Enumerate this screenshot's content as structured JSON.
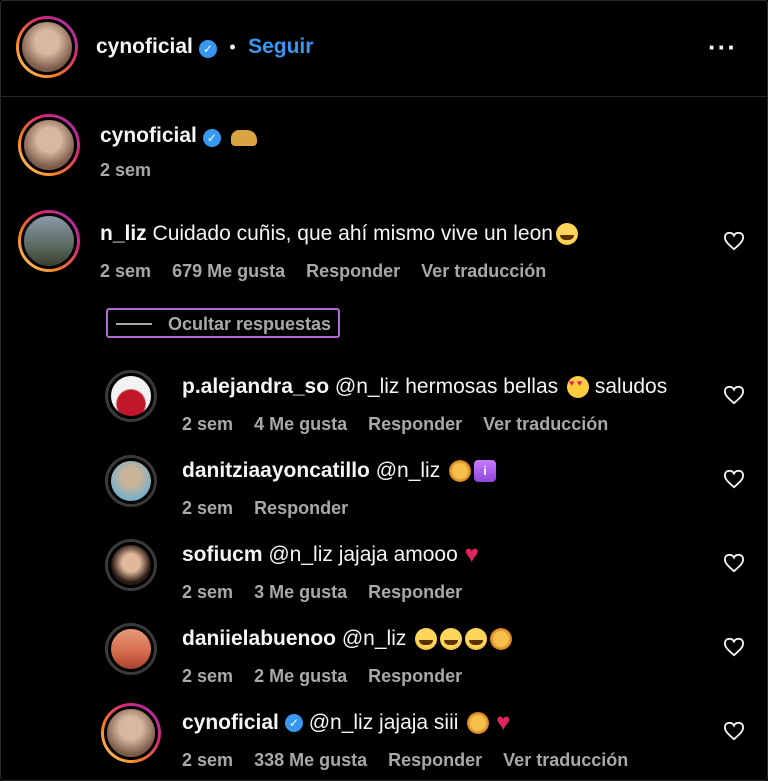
{
  "header": {
    "username": "cynoficial",
    "separator": "•",
    "follow_label": "Seguir",
    "more_icon": "more-horizontal-icon"
  },
  "caption": {
    "username": "cynoficial",
    "emoji": "leopard-emoji",
    "time": "2 sem"
  },
  "comment": {
    "username": "n_liz",
    "text": "Cuidado cuñis, que ahí mismo vive un leon",
    "emoji": "laughing-emoji",
    "time": "2 sem",
    "likes": "679 Me gusta",
    "reply_label": "Responder",
    "translate_label": "Ver traducción",
    "hide_replies_label": "Ocultar respuestas"
  },
  "replies": [
    {
      "username": "p.alejandra_so",
      "text": "@n_liz hermosas bellas",
      "emoji_after": "heart-eyes-emoji",
      "text2": "saludos",
      "time": "2 sem",
      "likes": "4 Me gusta",
      "reply_label": "Responder",
      "translate_label": "Ver traducción"
    },
    {
      "username": "danitziaayoncatillo",
      "text": "@n_liz",
      "time": "2 sem",
      "reply_label": "Responder"
    },
    {
      "username": "sofiucm",
      "text": "@n_liz jajaja amooo",
      "time": "2 sem",
      "likes": "3 Me gusta",
      "reply_label": "Responder"
    },
    {
      "username": "daniielabuenoo",
      "text": "@n_liz",
      "time": "2 sem",
      "likes": "2 Me gusta",
      "reply_label": "Responder"
    },
    {
      "username": "cynoficial",
      "text": "@n_liz jajaja siii",
      "time": "2 sem",
      "likes": "338 Me gusta",
      "reply_label": "Responder",
      "translate_label": "Ver traducción"
    }
  ],
  "colors": {
    "background": "#000000",
    "text": "#f5f5f5",
    "muted": "#a8a8a8",
    "link_blue": "#3897f0",
    "verified": "#3897f0",
    "highlight_border": "#b06bd0"
  }
}
